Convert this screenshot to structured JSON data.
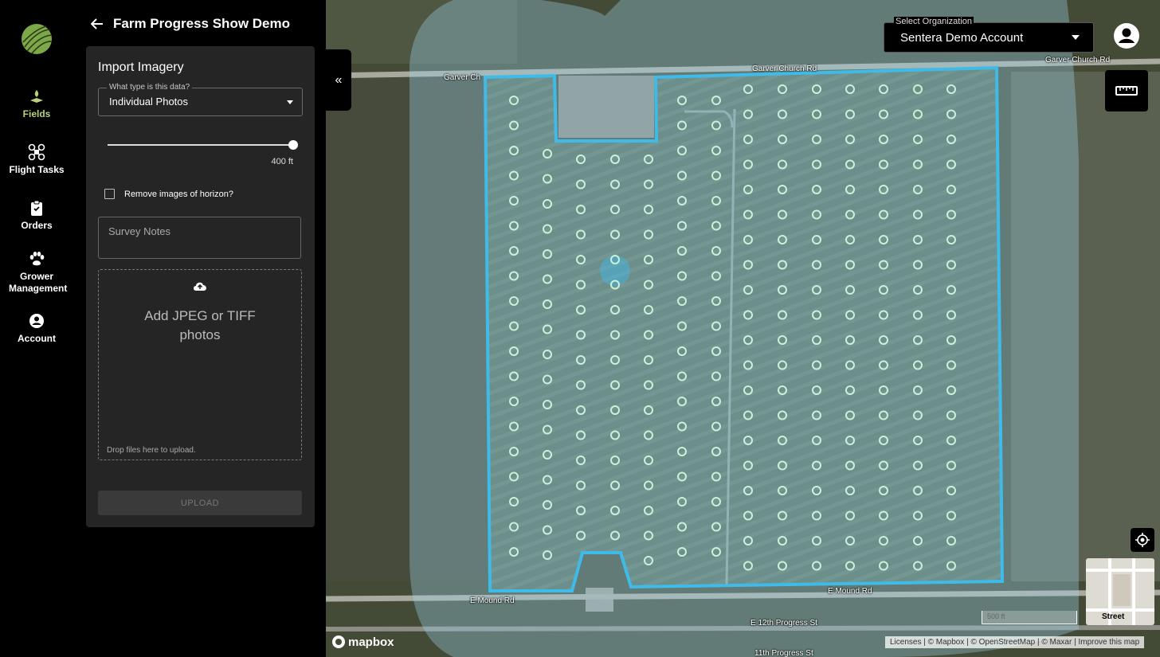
{
  "nav": {
    "items": [
      {
        "label": "Fields",
        "icon": "field-icon"
      },
      {
        "label": "Flight Tasks",
        "icon": "drone-icon"
      },
      {
        "label": "Orders",
        "icon": "clipboard-icon"
      },
      {
        "label": "Grower Management",
        "icon": "paw-icon"
      },
      {
        "label": "Account",
        "icon": "account-circle-icon"
      }
    ],
    "active_color": "#b8d27a"
  },
  "header": {
    "title": "Farm Progress Show Demo"
  },
  "panel": {
    "heading": "Import Imagery",
    "data_type": {
      "label": "What type is this data?",
      "value": "Individual Photos"
    },
    "altitude": {
      "value_label": "400 ft",
      "fraction": 1.0
    },
    "remove_horizon_label": "Remove images of horizon?",
    "survey_notes_placeholder": "Survey Notes",
    "dropzone": {
      "title": "Add JPEG or TIFF photos",
      "hint": "Drop files here to upload."
    },
    "upload_label": "UPLOAD"
  },
  "org": {
    "label": "Select Organization",
    "value": "Sentera Demo Account"
  },
  "map": {
    "roads": {
      "garver_church_1": "Garver Church Rd",
      "garver_church_2": "Garver Church Rd",
      "garver_west": "Garver Ch",
      "e_mound_west": "E Mound Rd",
      "e_mound_east": "E Mound Rd",
      "progress_st": "E 12th Progress St",
      "progress_st_2": "11th Progress St"
    },
    "minimap_label": "Street",
    "scale_label": "500 ft",
    "logo": "mapbox",
    "attribution": "Licenses | © Mapbox | © OpenStreetMap | © Maxar | Improve this map",
    "boundary_color": "#3fbbea",
    "point_color": "#cbf2d8"
  }
}
